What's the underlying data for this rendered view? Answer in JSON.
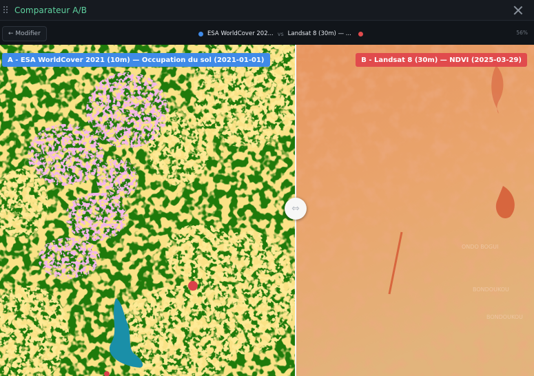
{
  "window": {
    "title": "Comparateur A/B"
  },
  "toolbar": {
    "edit_label": "← Modifier",
    "layer_a_short": "ESA WorldCover 202...",
    "vs_label": "vs",
    "layer_b_short": "Landsat 8 (30m) — ...",
    "zoom": "56%"
  },
  "compare": {
    "layer_a": {
      "label": "A - ESA WorldCover 2021 (10m) — Occupation du sol (2021-01-01)",
      "color": "#3f8ae8"
    },
    "layer_b": {
      "label": "B - Landsat 8 (30m) — NDVI (2025-03-29)",
      "color": "#e14b4d"
    },
    "slider_position": 0.555,
    "handle_icon": "horizontal-arrows-icon",
    "handle_glyph": "⇔"
  },
  "map_b_place_labels": [
    "ONDO BOGUI",
    "BONDOUKOU",
    "BONDOUKOU"
  ],
  "colors": {
    "landcover_tree": "#1f7a0b",
    "landcover_grass": "#f4c13e",
    "landcover_cropland": "#e679d4",
    "landcover_water": "#1a8fa8",
    "landcover_builtup": "#d9414a",
    "ndvi_low": "#e47a48",
    "ndvi_mid": "#e8a26a"
  }
}
